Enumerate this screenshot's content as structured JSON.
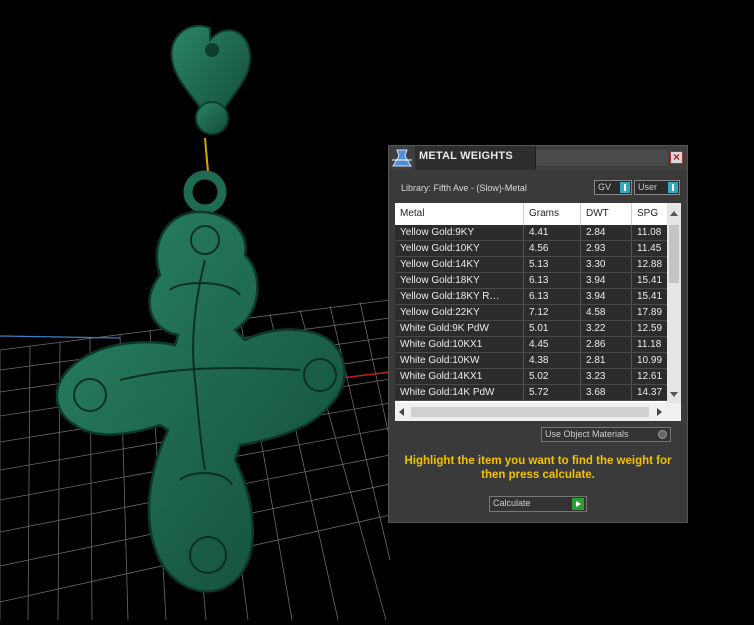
{
  "panel": {
    "title": "METAL WEIGHTS",
    "library_label": "Library: Fifth Ave - (Slow)-Metal",
    "toggle_gv": "GV",
    "toggle_user": "User",
    "table": {
      "headers": [
        "Metal",
        "Grams",
        "DWT",
        "SPG"
      ],
      "rows": [
        [
          "Yellow Gold:9KY",
          "4.41",
          "2.84",
          "11.08"
        ],
        [
          "Yellow Gold:10KY",
          "4.56",
          "2.93",
          "11.45"
        ],
        [
          "Yellow Gold:14KY",
          "5.13",
          "3.30",
          "12.88"
        ],
        [
          "Yellow Gold:18KY",
          "6.13",
          "3.94",
          "15.41"
        ],
        [
          "Yellow Gold:18KY R…",
          "6.13",
          "3.94",
          "15.41"
        ],
        [
          "Yellow Gold:22KY",
          "7.12",
          "4.58",
          "17.89"
        ],
        [
          "White Gold:9K PdW",
          "5.01",
          "3.22",
          "12.59"
        ],
        [
          "White Gold:10KX1",
          "4.45",
          "2.86",
          "11.18"
        ],
        [
          "White Gold:10KW",
          "4.38",
          "2.81",
          "10.99"
        ],
        [
          "White Gold:14KX1",
          "5.02",
          "3.23",
          "12.61"
        ],
        [
          "White Gold:14K PdW",
          "5.72",
          "3.68",
          "14.37"
        ]
      ]
    },
    "use_object_materials": "Use Object Materials",
    "hint": "Highlight the item you want to find the weight for then press calculate.",
    "calculate_label": "Calculate"
  },
  "icons": {
    "app": "flask-scale-icon",
    "close": "close-icon",
    "scroll_up": "arrow-up-icon",
    "scroll_down": "arrow-down-icon",
    "scroll_left": "arrow-left-icon",
    "scroll_right": "arrow-right-icon",
    "calculate": "play-icon"
  },
  "colors": {
    "viewport_bg": "#000000",
    "model": "#1f6b4f",
    "hint": "#f2c200",
    "toggle_accent": "#2fa8c7",
    "calc_accent": "#2f9f2f"
  }
}
